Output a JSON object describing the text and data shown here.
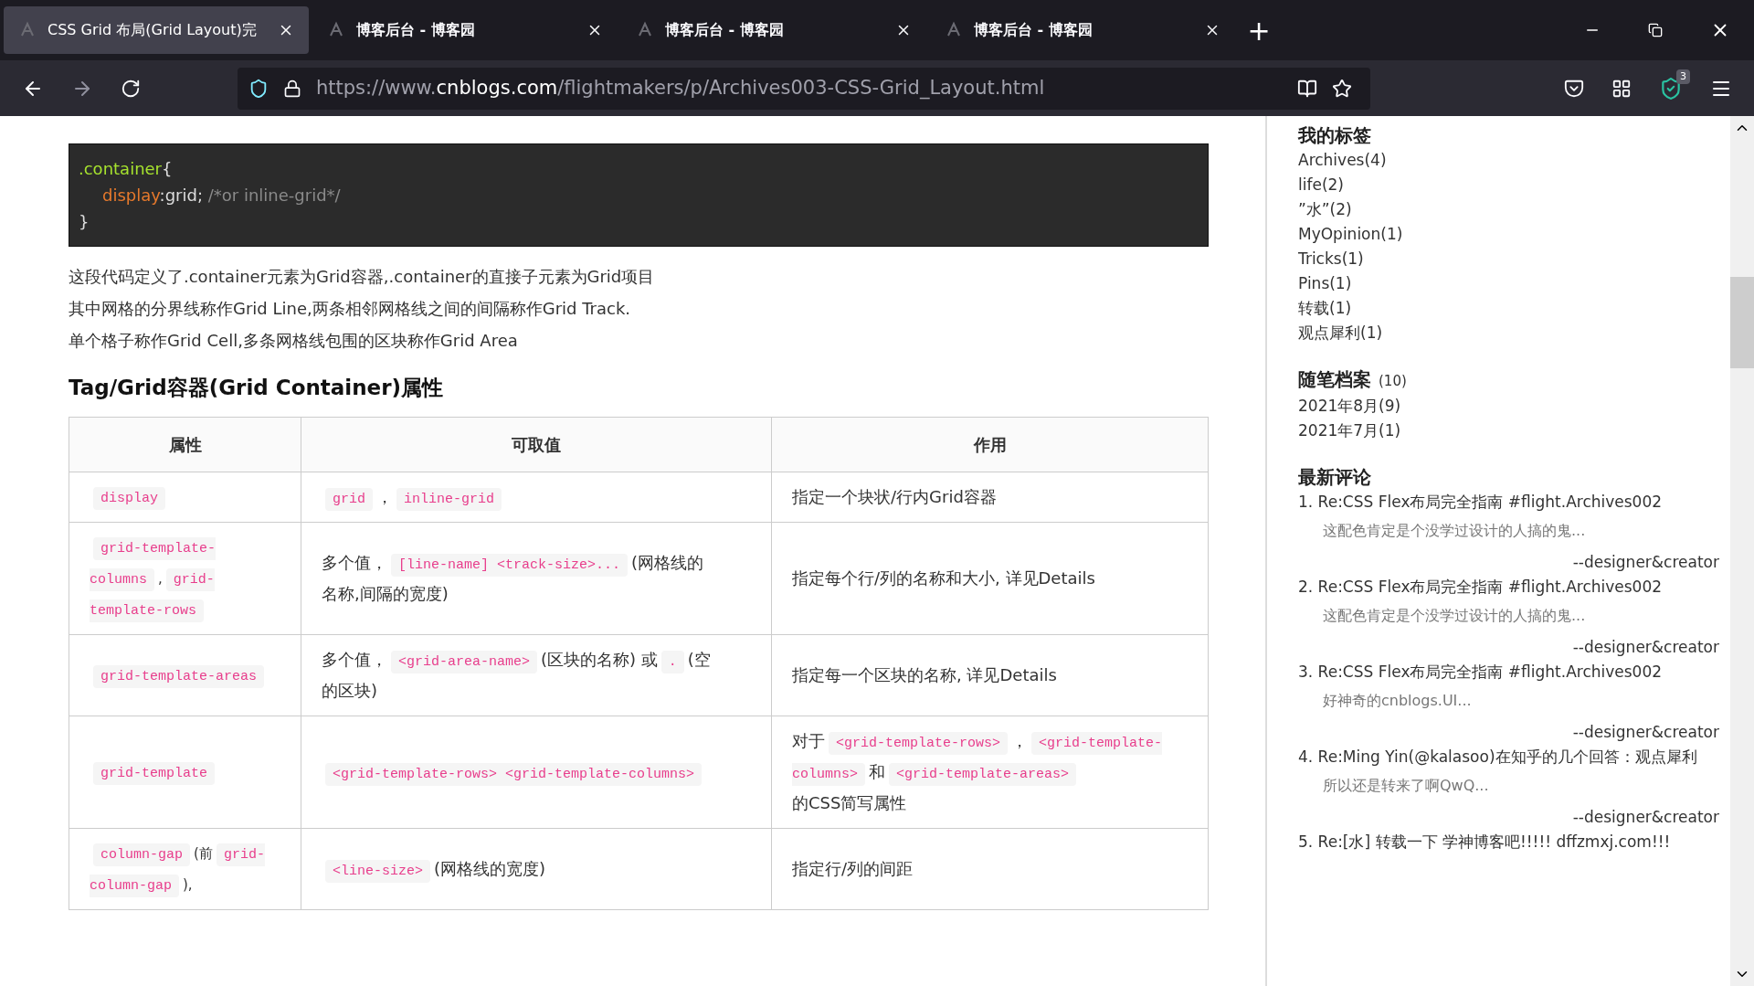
{
  "browser": {
    "tabs": [
      {
        "title": "CSS Grid 布局(Grid Layout)完",
        "selected": true
      },
      {
        "title": "博客后台 - 博客园",
        "selected": false
      },
      {
        "title": "博客后台 - 博客园",
        "selected": false
      },
      {
        "title": "博客后台 - 博客园",
        "selected": false
      }
    ],
    "new_tab": "+",
    "url": {
      "prefix": "https://www.",
      "domain": "cnblogs.com",
      "path": "/flightmakers/p/Archives003-CSS-Grid_Layout.html"
    },
    "badge": "3"
  },
  "article": {
    "code": [
      [
        {
          "kind": "selector",
          "text": ".container"
        },
        {
          "kind": "punct",
          "text": "{"
        }
      ],
      [
        {
          "kind": "property",
          "text": "display"
        },
        {
          "kind": "punct",
          "text": ":grid; "
        },
        {
          "kind": "comment",
          "text": "/*or inline-grid*/"
        }
      ],
      [
        {
          "kind": "punct",
          "text": "}"
        }
      ]
    ],
    "paragraphs": [
      "这段代码定义了.container元素为Grid容器,.container的直接子元素为Grid项目",
      "其中网格的分界线称作Grid Line,两条相邻网格线之间的间隔称作Grid Track.",
      "单个格子称作Grid Cell,多条网格线包围的区块称作Grid Area"
    ],
    "heading": "Tag/Grid容器(Grid Container)属性",
    "table": {
      "columns": [
        "属性",
        "可取值",
        "作用"
      ],
      "rows": [
        [
          [
            {
              "kind": "code",
              "text": "display"
            }
          ],
          [
            {
              "kind": "code",
              "text": "grid"
            },
            {
              "kind": "text",
              "text": "，"
            },
            {
              "kind": "code",
              "text": "inline-grid"
            }
          ],
          [
            {
              "kind": "text",
              "text": "指定一个块状/行内Grid容器"
            }
          ]
        ],
        [
          [
            {
              "kind": "code",
              "text": "grid-template-columns"
            },
            {
              "kind": "text",
              "text": ","
            },
            {
              "kind": "code",
              "text": "grid-template-rows"
            }
          ],
          [
            {
              "kind": "text",
              "text": "多个值，"
            },
            {
              "kind": "code",
              "text": "[line-name] <track-size>..."
            },
            {
              "kind": "text",
              "text": "(网格线的"
            },
            {
              "kind": "text",
              "text": "名称,间隔的宽度)"
            }
          ],
          [
            {
              "kind": "text",
              "text": "指定每个行/列的名称和大小, 详见Details"
            }
          ]
        ],
        [
          [
            {
              "kind": "code",
              "text": "grid-template-areas"
            }
          ],
          [
            {
              "kind": "text",
              "text": "多个值，"
            },
            {
              "kind": "code",
              "text": "<grid-area-name>"
            },
            {
              "kind": "text",
              "text": "(区块的名称) 或"
            },
            {
              "kind": "code",
              "text": "."
            },
            {
              "kind": "text",
              "text": "(空"
            },
            {
              "kind": "text",
              "text": "的区块)"
            }
          ],
          [
            {
              "kind": "text",
              "text": "指定每一个区块的名称, 详见Details"
            }
          ]
        ],
        [
          [
            {
              "kind": "code",
              "text": "grid-template"
            }
          ],
          [
            {
              "kind": "code",
              "text": "<grid-template-rows> <grid-template-columns>"
            }
          ],
          [
            {
              "kind": "text",
              "text": "对于"
            },
            {
              "kind": "code",
              "text": "<grid-template-rows>"
            },
            {
              "kind": "text",
              "text": "，"
            },
            {
              "kind": "code",
              "text": "<grid-template-columns>"
            },
            {
              "kind": "text",
              "text": "和"
            },
            {
              "kind": "code",
              "text": "<grid-template-areas>"
            },
            {
              "kind": "text",
              "text": "的CSS简写属性"
            }
          ]
        ],
        [
          [
            {
              "kind": "code",
              "text": "column-gap"
            },
            {
              "kind": "text",
              "text": "(前"
            },
            {
              "kind": "code",
              "text": "grid-column-gap"
            },
            {
              "kind": "text",
              "text": "),"
            }
          ],
          [
            {
              "kind": "code",
              "text": "<line-size>"
            },
            {
              "kind": "text",
              "text": "(网格线的宽度)"
            }
          ],
          [
            {
              "kind": "text",
              "text": "指定行/列的间距"
            }
          ]
        ]
      ]
    }
  },
  "sidebar": {
    "tags": {
      "title": "我的标签",
      "items": [
        "Archives(4)",
        "life(2)",
        "”水”(2)",
        "MyOpinion(1)",
        "Tricks(1)",
        "Pins(1)",
        "转载(1)",
        "观点犀利(1)"
      ]
    },
    "archive": {
      "title": "随笔档案",
      "count": "(10)",
      "items": [
        "2021年8月(9)",
        "2021年7月(1)"
      ]
    },
    "comments": {
      "title": "最新评论",
      "items": [
        {
          "title": "1. Re:CSS Flex布局完全指南 #flight.Archives002",
          "body": "这配色肯定是个没学过设计的人搞的鬼...",
          "author": "--designer&creator"
        },
        {
          "title": "2. Re:CSS Flex布局完全指南 #flight.Archives002",
          "body": "这配色肯定是个没学过设计的人搞的鬼...",
          "author": "--designer&creator"
        },
        {
          "title": "3. Re:CSS Flex布局完全指南 #flight.Archives002",
          "body": "好神奇的cnblogs.UI...",
          "author": "--designer&creator"
        },
        {
          "title": "4. Re:Ming Yin(@kalasoo)在知乎的几个回答：观点犀利",
          "body": "所以还是转来了啊QwQ...",
          "author": "--designer&creator"
        },
        {
          "title": "5. Re:[水] 转载一下 学神博客吧!!!!! dffzmxj.com!!!"
        }
      ]
    }
  }
}
